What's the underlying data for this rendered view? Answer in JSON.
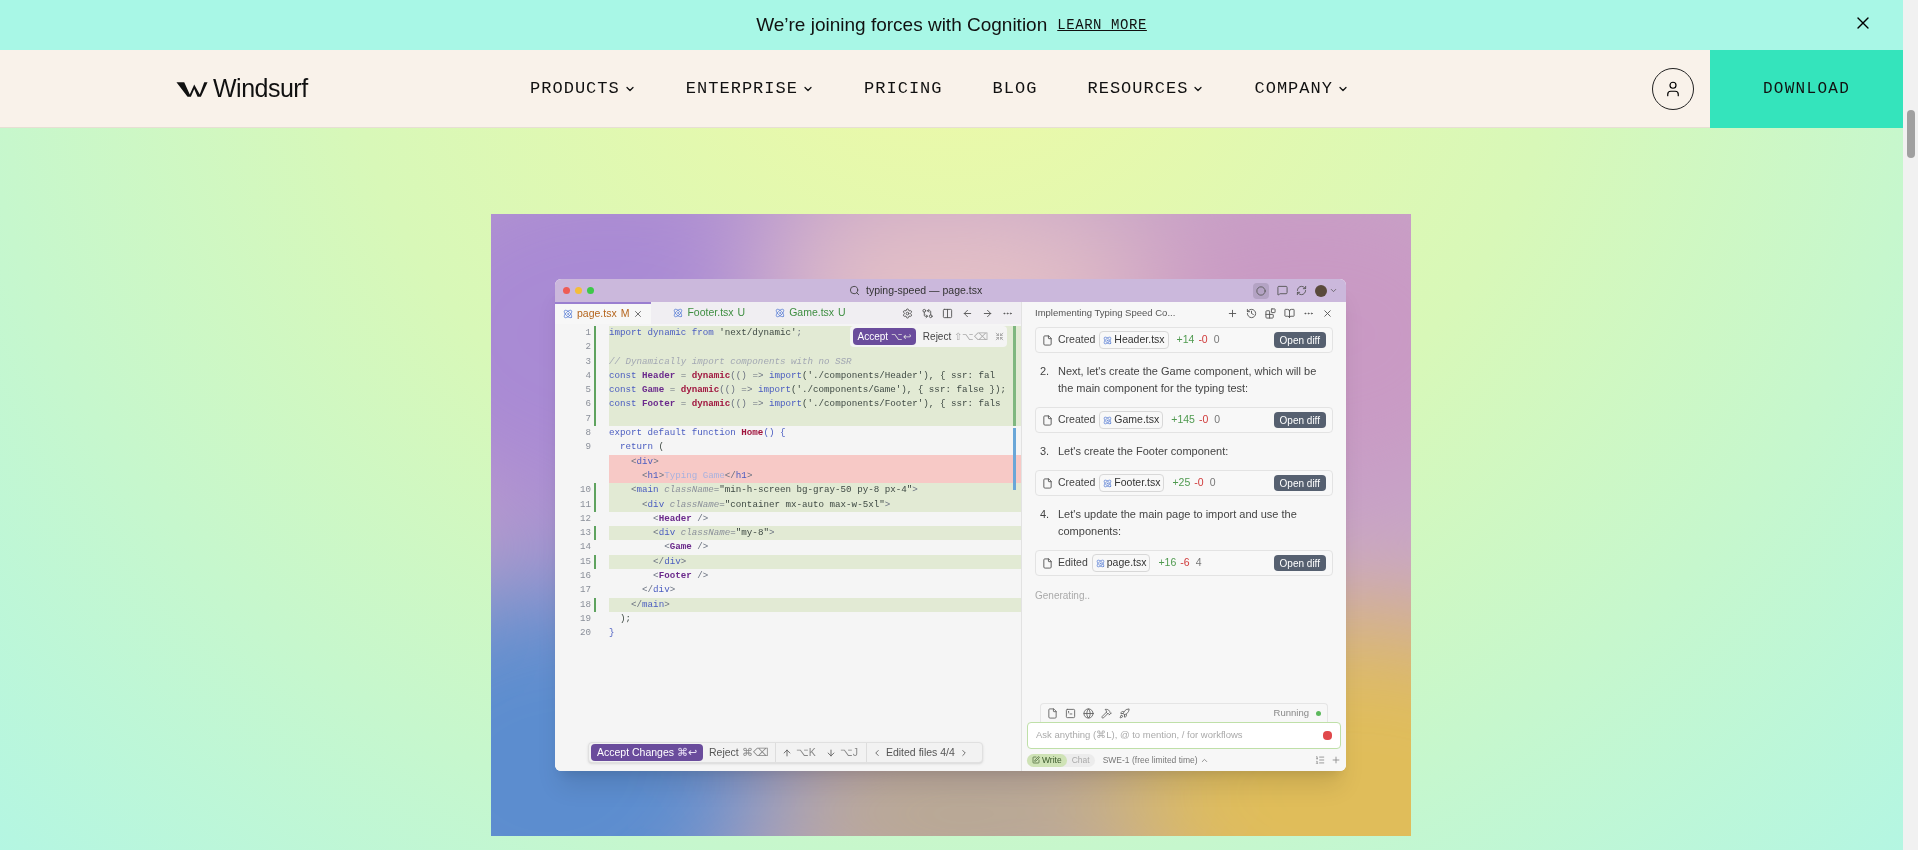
{
  "banner": {
    "text": "We’re joining forces with Cognition",
    "link": "LEARN MORE"
  },
  "nav": {
    "brand": "Windsurf",
    "items": [
      {
        "label": "PRODUCTS",
        "dropdown": true
      },
      {
        "label": "ENTERPRISE",
        "dropdown": true
      },
      {
        "label": "PRICING",
        "dropdown": false
      },
      {
        "label": "BLOG",
        "dropdown": false
      },
      {
        "label": "RESOURCES",
        "dropdown": true
      },
      {
        "label": "COMPANY",
        "dropdown": true
      }
    ],
    "cta": "DOWNLOAD"
  },
  "editor": {
    "title": "typing-speed — page.tsx",
    "tabs": [
      {
        "label": "page.tsx",
        "status": "M",
        "selected": true
      },
      {
        "label": "Footer.tsx",
        "status": "U",
        "selected": false
      },
      {
        "label": "Game.tsx",
        "status": "U",
        "selected": false
      }
    ],
    "inline_actions": {
      "accept": "Accept",
      "accept_keys": "⌥↩",
      "reject": "Reject",
      "reject_keys": "⇧⌥⌫"
    },
    "lines": [
      {
        "number": "1",
        "kind": "added",
        "tokens": [
          {
            "kind": "kw",
            "text": "import dynamic from "
          },
          {
            "kind": "str",
            "text": "'next/dynamic'"
          },
          {
            "kind": "p",
            "text": ";"
          }
        ]
      },
      {
        "number": "2",
        "kind": "added"
      },
      {
        "number": "3",
        "kind": "added",
        "tokens": [
          {
            "kind": "com",
            "text": "// Dynamically import components with no SSR"
          }
        ]
      },
      {
        "number": "4",
        "kind": "added",
        "tokens": [
          {
            "kind": "kw",
            "text": "const "
          },
          {
            "kind": "name",
            "text": "Header"
          },
          {
            "kind": "p",
            "text": " = "
          },
          {
            "kind": "fn",
            "text": "dynamic"
          },
          {
            "kind": "p",
            "text": "(() => "
          },
          {
            "kind": "kw",
            "text": "import"
          },
          {
            "kind": "str",
            "text": "('./components/Header'), { ssr: fal"
          }
        ]
      },
      {
        "number": "5",
        "kind": "added",
        "tokens": [
          {
            "kind": "kw",
            "text": "const "
          },
          {
            "kind": "name",
            "text": "Game"
          },
          {
            "kind": "p",
            "text": " = "
          },
          {
            "kind": "fn",
            "text": "dynamic"
          },
          {
            "kind": "p",
            "text": "(() => "
          },
          {
            "kind": "kw",
            "text": "import"
          },
          {
            "kind": "str",
            "text": "('./components/Game'), { ssr: false });"
          }
        ]
      },
      {
        "number": "6",
        "kind": "added",
        "tokens": [
          {
            "kind": "kw",
            "text": "const "
          },
          {
            "kind": "name",
            "text": "Footer"
          },
          {
            "kind": "p",
            "text": " = "
          },
          {
            "kind": "fn",
            "text": "dynamic"
          },
          {
            "kind": "p",
            "text": "(() => "
          },
          {
            "kind": "kw",
            "text": "import"
          },
          {
            "kind": "str",
            "text": "('./components/Footer'), { ssr: fals"
          }
        ]
      },
      {
        "number": "7",
        "kind": "added"
      },
      {
        "number": "8",
        "kind": "plain",
        "tokens": [
          {
            "kind": "kw",
            "text": "export default function "
          },
          {
            "kind": "fn",
            "text": "Home"
          },
          {
            "kind": "kw",
            "text": "() {"
          }
        ]
      },
      {
        "number": "9",
        "kind": "plain",
        "tokens": [
          {
            "kind": "kw",
            "text": "  return"
          },
          {
            "kind": "str",
            "text": " ("
          }
        ]
      },
      {
        "kind": "removed",
        "tokens": [
          {
            "kind": "p",
            "text": "    <"
          },
          {
            "kind": "tag",
            "text": "div"
          },
          {
            "kind": "p",
            "text": ">"
          }
        ]
      },
      {
        "kind": "removed",
        "tokens": [
          {
            "kind": "p",
            "text": "      <"
          },
          {
            "kind": "tag",
            "text": "h1"
          },
          {
            "kind": "p",
            "text": ">"
          },
          {
            "kind": "txt",
            "text": "Typing Game"
          },
          {
            "kind": "p",
            "text": "</"
          },
          {
            "kind": "tag",
            "text": "h1"
          },
          {
            "kind": "p",
            "text": ">"
          }
        ]
      },
      {
        "number": "10",
        "kind": "added",
        "tokens": [
          {
            "kind": "p",
            "text": "    <"
          },
          {
            "kind": "tag",
            "text": "main"
          },
          {
            "kind": "attr",
            "text": " className"
          },
          {
            "kind": "p",
            "text": "="
          },
          {
            "kind": "str",
            "text": "\"min-h-screen bg-gray-50 py-8 px-4\""
          },
          {
            "kind": "p",
            "text": ">"
          }
        ]
      },
      {
        "number": "11",
        "kind": "added",
        "tokens": [
          {
            "kind": "p",
            "text": "      <"
          },
          {
            "kind": "tag",
            "text": "div"
          },
          {
            "kind": "attr",
            "text": " className"
          },
          {
            "kind": "p",
            "text": "="
          },
          {
            "kind": "str",
            "text": "\"container mx-auto max-w-5xl\""
          },
          {
            "kind": "p",
            "text": ">"
          }
        ]
      },
      {
        "number": "12",
        "kind": "plain",
        "tokens": [
          {
            "kind": "p",
            "text": "        <"
          },
          {
            "kind": "name",
            "text": "Header"
          },
          {
            "kind": "p",
            "text": " />"
          }
        ]
      },
      {
        "number": "13",
        "kind": "added",
        "tokens": [
          {
            "kind": "p",
            "text": "        <"
          },
          {
            "kind": "tag",
            "text": "div"
          },
          {
            "kind": "attr",
            "text": " className"
          },
          {
            "kind": "p",
            "text": "="
          },
          {
            "kind": "str",
            "text": "\"my-8\""
          },
          {
            "kind": "p",
            "text": ">"
          }
        ]
      },
      {
        "number": "14",
        "kind": "plain",
        "tokens": [
          {
            "kind": "p",
            "text": "          <"
          },
          {
            "kind": "name",
            "text": "Game"
          },
          {
            "kind": "p",
            "text": " />"
          }
        ]
      },
      {
        "number": "15",
        "kind": "added",
        "tokens": [
          {
            "kind": "p",
            "text": "        </"
          },
          {
            "kind": "tag",
            "text": "div"
          },
          {
            "kind": "p",
            "text": ">"
          }
        ]
      },
      {
        "number": "16",
        "kind": "plain",
        "tokens": [
          {
            "kind": "p",
            "text": "        <"
          },
          {
            "kind": "name",
            "text": "Footer"
          },
          {
            "kind": "p",
            "text": " />"
          }
        ]
      },
      {
        "number": "17",
        "kind": "plain",
        "tokens": [
          {
            "kind": "p",
            "text": "      </"
          },
          {
            "kind": "tag",
            "text": "div"
          },
          {
            "kind": "p",
            "text": ">"
          }
        ]
      },
      {
        "number": "18",
        "kind": "added",
        "tokens": [
          {
            "kind": "p",
            "text": "    </"
          },
          {
            "kind": "tag",
            "text": "main"
          },
          {
            "kind": "p",
            "text": ">"
          }
        ]
      },
      {
        "number": "19",
        "kind": "plain",
        "tokens": [
          {
            "kind": "str",
            "text": "  );"
          }
        ]
      },
      {
        "number": "20",
        "kind": "plain",
        "tokens": [
          {
            "kind": "kw",
            "text": "}"
          }
        ]
      }
    ],
    "review_bar": {
      "accept": "Accept Changes",
      "accept_keys": "⌘↩",
      "reject": "Reject",
      "reject_keys": "⌘⌫",
      "up_keys": "⌥K",
      "down_keys": "⌥J",
      "files": "Edited files 4/4"
    }
  },
  "chat": {
    "title": "Implementing Typing Speed Co...",
    "items": [
      {
        "kind": "file",
        "action": "Created",
        "file": "Header.tsx",
        "added": "+14",
        "removed": "-0",
        "count": "0",
        "button": "Open diff"
      },
      {
        "kind": "step",
        "number": "2.",
        "text": "Next, let's create the Game component, which will be the main component for the typing test:"
      },
      {
        "kind": "file",
        "action": "Created",
        "file": "Game.tsx",
        "added": "+145",
        "removed": "-0",
        "count": "0",
        "button": "Open diff"
      },
      {
        "kind": "step",
        "number": "3.",
        "text": "Let's create the Footer component:"
      },
      {
        "kind": "file",
        "action": "Created",
        "file": "Footer.tsx",
        "added": "+25",
        "removed": "-0",
        "count": "0",
        "button": "Open diff"
      },
      {
        "kind": "step",
        "number": "4.",
        "text": "Let's update the main page to import and use the components:"
      },
      {
        "kind": "file",
        "action": "Edited",
        "file": "page.tsx",
        "added": "+16",
        "removed": "-6",
        "count": "4",
        "button": "Open diff"
      }
    ],
    "status": "Generating..",
    "tool_status": "Running",
    "placeholder": "Ask anything (⌘L), @ to mention, / for workflows",
    "modes": [
      {
        "label": "Write",
        "selected": true
      },
      {
        "label": "Chat",
        "selected": false
      }
    ],
    "model": "SWE-1 (free limited time)"
  }
}
